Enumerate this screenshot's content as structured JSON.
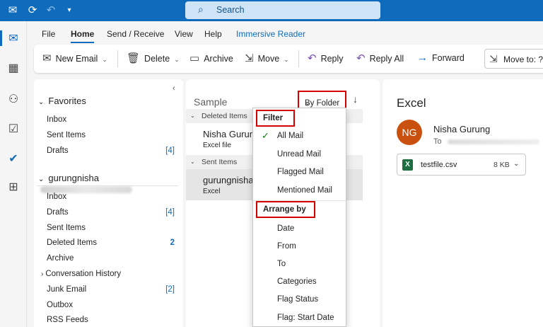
{
  "titlebar": {
    "search_placeholder": "Search"
  },
  "menu": {
    "file": "File",
    "home": "Home",
    "send_receive": "Send / Receive",
    "view": "View",
    "help": "Help",
    "immersive_reader": "Immersive Reader"
  },
  "ribbon": {
    "new_email": "New Email",
    "delete": "Delete",
    "archive": "Archive",
    "move": "Move",
    "reply": "Reply",
    "reply_all": "Reply All",
    "forward": "Forward",
    "move_to": "Move to: ?"
  },
  "folders": {
    "favorites": {
      "label": "Favorites",
      "items": [
        {
          "label": "Inbox",
          "count": ""
        },
        {
          "label": "Sent Items",
          "count": ""
        },
        {
          "label": "Drafts",
          "count": "[4]"
        }
      ]
    },
    "account": {
      "label": "gurungnisha",
      "items": [
        {
          "label": "Inbox",
          "count": ""
        },
        {
          "label": "Drafts",
          "count": "[4]"
        },
        {
          "label": "Sent Items",
          "count": ""
        },
        {
          "label": "Deleted Items",
          "count": "2"
        },
        {
          "label": "Archive",
          "count": ""
        },
        {
          "label": "Conversation History",
          "count": ""
        },
        {
          "label": "Junk Email",
          "count": "[2]"
        },
        {
          "label": "Outbox",
          "count": ""
        },
        {
          "label": "RSS Feeds",
          "count": ""
        }
      ]
    }
  },
  "message_list": {
    "folder_name": "Sample",
    "sort_label": "By Folder",
    "groups": [
      {
        "label": "Deleted Items",
        "message": {
          "from": "Nisha Gurung",
          "subject": "Excel file"
        }
      },
      {
        "label": "Sent Items",
        "message": {
          "from": "gurungnisha",
          "subject": "Excel"
        }
      }
    ]
  },
  "dropdown": {
    "filter_header": "Filter",
    "filter_items": [
      "All Mail",
      "Unread Mail",
      "Flagged Mail",
      "Mentioned Mail"
    ],
    "arrange_header": "Arrange by",
    "arrange_items": [
      "Date",
      "From",
      "To",
      "Categories",
      "Flag Status",
      "Flag: Start Date"
    ]
  },
  "reading_pane": {
    "subject": "Excel",
    "avatar_initials": "NG",
    "sender": "Nisha Gurung",
    "to_label": "To",
    "attachment": {
      "name": "testfile.csv",
      "size": "8 KB"
    }
  }
}
